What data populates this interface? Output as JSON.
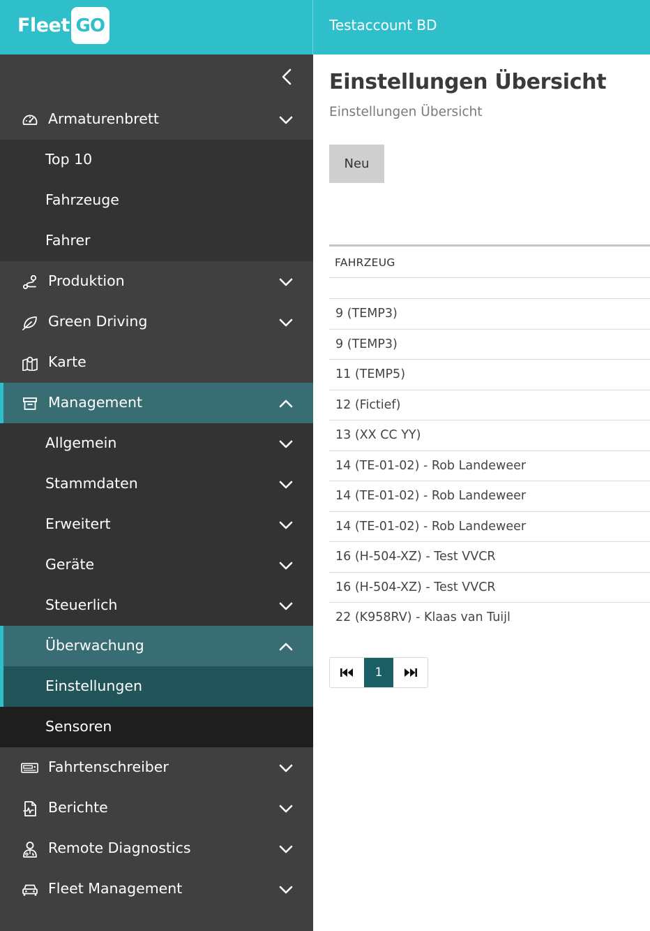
{
  "brand": {
    "logo_word": "Fleet",
    "logo_badge": "GO",
    "account": "Testaccount BD"
  },
  "colors": {
    "header": "#2fbfcb",
    "sidebar": "#404040",
    "submenu": "#333333",
    "active": "#386e73",
    "current": "#21555a",
    "pager_active": "#1b5f66"
  },
  "sidebar": {
    "collapse_icon": "chevron-left-icon",
    "items": [
      {
        "label": "Armaturenbrett",
        "icon": "speedometer-icon",
        "expanded": true,
        "children": [
          {
            "label": "Top 10"
          },
          {
            "label": "Fahrzeuge"
          },
          {
            "label": "Fahrer"
          }
        ]
      },
      {
        "label": "Produktion",
        "icon": "route-icon"
      },
      {
        "label": "Green Driving",
        "icon": "leaf-icon"
      },
      {
        "label": "Karte",
        "icon": "map-icon"
      },
      {
        "label": "Management",
        "icon": "archive-icon",
        "expanded": true,
        "children": [
          {
            "label": "Allgemein"
          },
          {
            "label": "Stammdaten"
          },
          {
            "label": "Erweitert"
          },
          {
            "label": "Geräte"
          },
          {
            "label": "Steuerlich"
          },
          {
            "label": "Überwachung",
            "expanded": true,
            "children": [
              {
                "label": "Einstellungen",
                "current": true
              },
              {
                "label": "Sensoren"
              }
            ]
          }
        ]
      },
      {
        "label": "Fahrtenschreiber",
        "icon": "tachograph-icon"
      },
      {
        "label": "Berichte",
        "icon": "report-icon"
      },
      {
        "label": "Remote Diagnostics",
        "icon": "technician-icon"
      },
      {
        "label": "Fleet Management",
        "icon": "car-icon"
      }
    ]
  },
  "main": {
    "title": "Einstellungen Übersicht",
    "subtitle": "Einstellungen Übersicht",
    "new_button": "Neu",
    "table": {
      "column_header": "FAHRZEUG",
      "rows": [
        "9 (TEMP3)",
        "9 (TEMP3)",
        "11 (TEMP5)",
        "12 (Fictief)",
        "13 (XX CC YY)",
        "14 (TE-01-02) - Rob Landeweer",
        "14 (TE-01-02) - Rob Landeweer",
        "14 (TE-01-02) - Rob Landeweer",
        "16 (H-504-XZ) - Test VVCR",
        "16 (H-504-XZ) - Test VVCR",
        "22 (K958RV) - Klaas van Tuijl"
      ]
    },
    "pagination": {
      "current_page": "1",
      "first_icon": "first-page-icon",
      "last_icon": "last-page-icon"
    }
  }
}
